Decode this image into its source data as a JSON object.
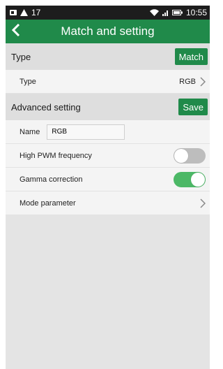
{
  "status_bar": {
    "notification_text": "17",
    "time": "10:55",
    "icons": [
      "sd-card-icon",
      "warning-icon",
      "wifi-icon",
      "signal-icon",
      "battery-icon"
    ]
  },
  "app_bar": {
    "title": "Match and setting",
    "back_icon": "back-arrow-icon"
  },
  "type_section": {
    "header": "Type",
    "match_label": "Match"
  },
  "type_row": {
    "label": "Type",
    "value": "RGB"
  },
  "advanced_section": {
    "header": "Advanced setting",
    "save_label": "Save"
  },
  "name_row": {
    "label": "Name",
    "value": "RGB"
  },
  "pwm_row": {
    "label": "High PWM frequency",
    "enabled": false
  },
  "gamma_row": {
    "label": "Gamma correction",
    "enabled": true
  },
  "mode_row": {
    "label": "Mode parameter"
  },
  "colors": {
    "accent": "#208a4a",
    "toggle_on": "#4cb866",
    "toggle_off": "#bdbdbd"
  }
}
